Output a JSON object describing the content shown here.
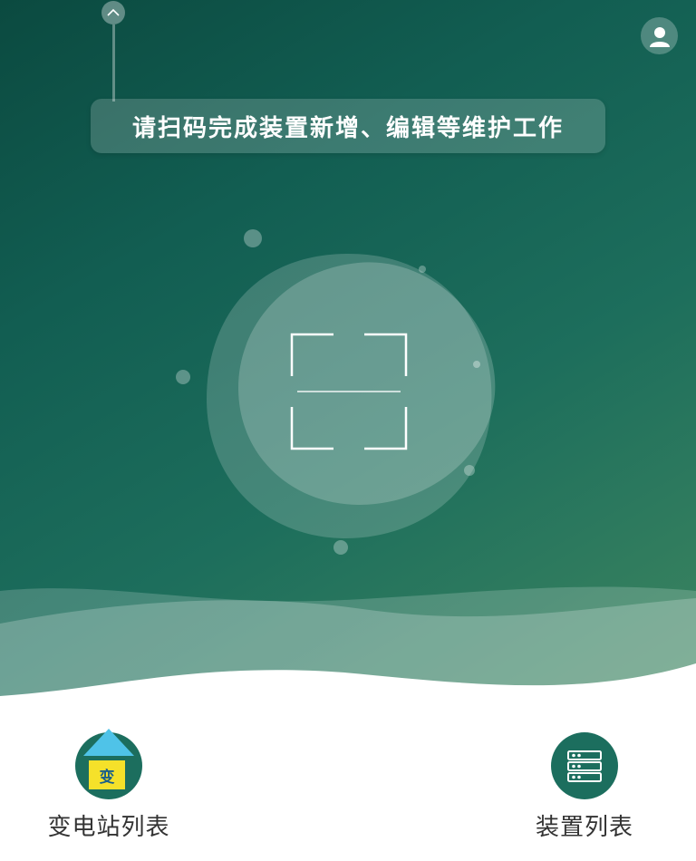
{
  "banner": {
    "text": "请扫码完成装置新增、编辑等维护工作"
  },
  "header": {
    "pull_handle_icon": "chevron-up-icon",
    "avatar_icon": "user-icon"
  },
  "scan": {
    "icon": "scan-frame-icon"
  },
  "bottom_nav": {
    "items": [
      {
        "label": "变电站列表",
        "icon": "substation-icon",
        "badge": "变"
      },
      {
        "label": "装置列表",
        "icon": "server-list-icon"
      }
    ]
  },
  "colors": {
    "hero_dark": "#0b4a40",
    "hero_light": "#3f8760",
    "nav_icon_bg": "#1c6e5e",
    "badge_yellow": "#f5e12a",
    "roof_blue": "#4fc3e8"
  }
}
